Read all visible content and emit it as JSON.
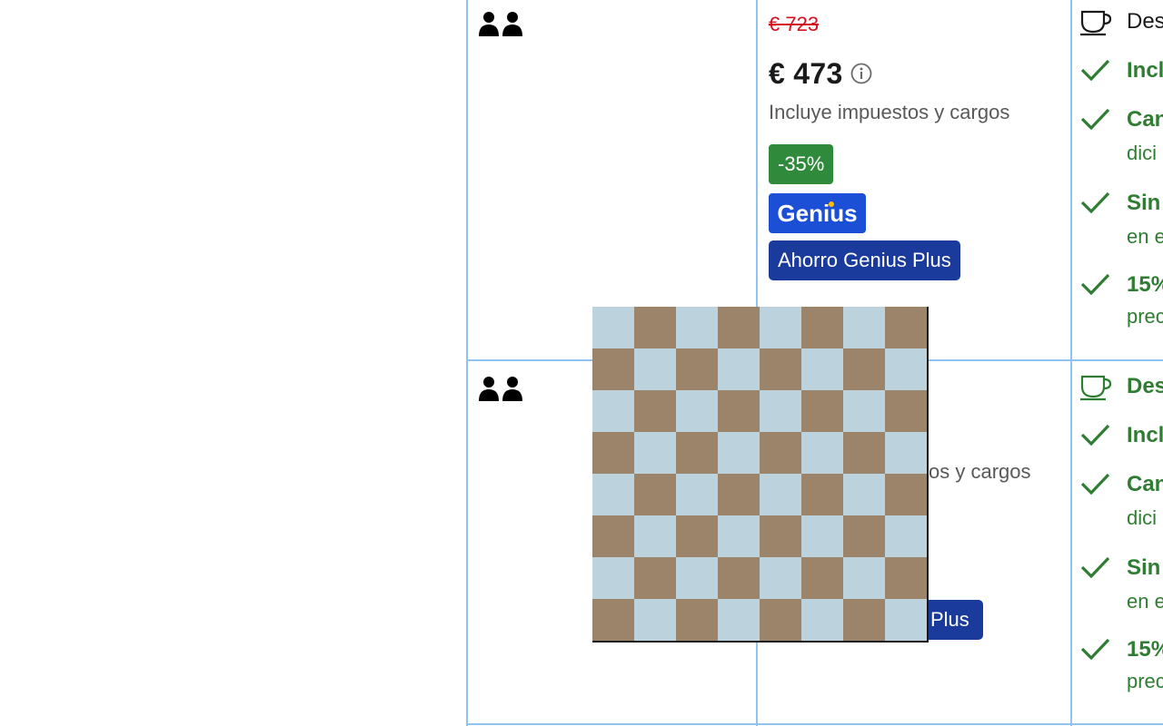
{
  "rows": [
    {
      "old_price": "€ 723",
      "price": "€ 473",
      "taxes": "Incluye impuestos y cargos",
      "discount": "-35%",
      "genius_logo": "Genius",
      "genius_plus": "Ahorro Genius Plus",
      "features": {
        "breakfast": "Des",
        "included": "Incl",
        "cancel_title": "Can",
        "cancel_sub": "dici",
        "nopay_title": "Sin",
        "nopay_sub": "en e",
        "percent_title": "15%",
        "percent_sub": "prec"
      }
    },
    {
      "taxes_fragment": "os y cargos",
      "plus_fragment": "Plus",
      "features": {
        "breakfast": "Des",
        "included": "Incl",
        "cancel_title": "Can",
        "cancel_sub": "dici",
        "nopay_title": "Sin",
        "nopay_sub": "en e",
        "percent_title": "15%",
        "percent_sub": "prec"
      }
    }
  ],
  "icons": {
    "guests": "guests-icon",
    "info": "info-icon",
    "breakfast": "coffee-cup-icon",
    "check": "check-icon"
  },
  "colors": {
    "old_price": "#d4111e",
    "discount_badge": "#2f8a3b",
    "genius_blue": "#1a4fd6",
    "genius_plus_blue": "#1a3a9c",
    "feature_green": "#2f7d32",
    "table_border": "#8ec3f2",
    "chess_light": "#bcd3dd",
    "chess_dark": "#9c846a"
  }
}
